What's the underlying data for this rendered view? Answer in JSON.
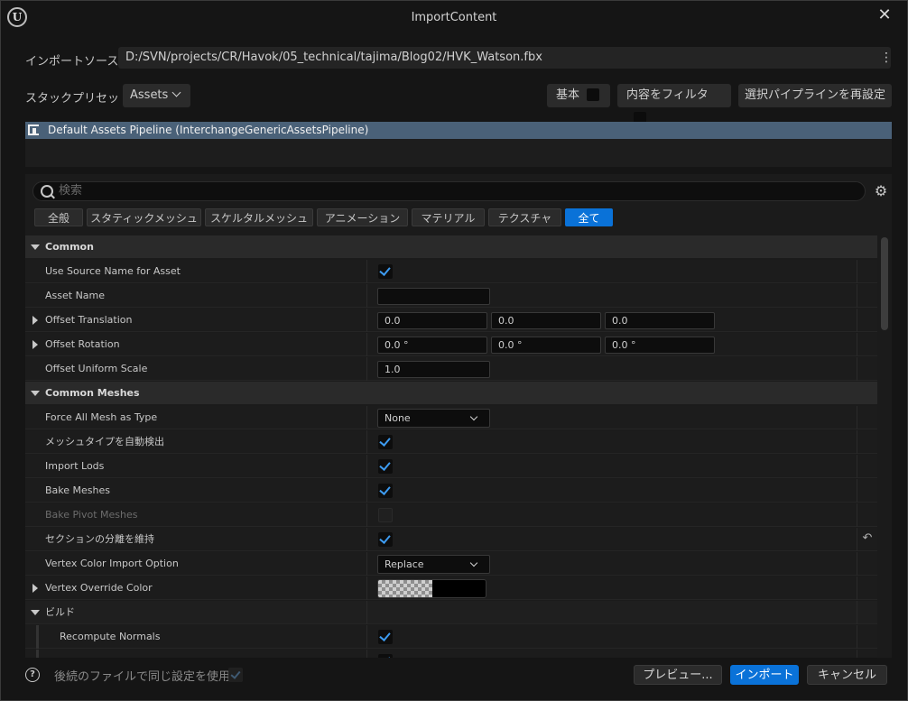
{
  "window": {
    "title": "ImportContent",
    "close_icon": "close-icon",
    "logo": "unreal-logo"
  },
  "source": {
    "label": "インポートソース",
    "path": "D:/SVN/projects/CR/Havok/05_technical/tajima/Blog02/HVK_Watson.fbx"
  },
  "stack": {
    "label": "スタックプリセット",
    "value": "Assets"
  },
  "toolbar": {
    "basic": "基本",
    "filter": "内容をフィルタ",
    "reset": "選択パイプラインを再設定"
  },
  "pipeline": {
    "label": "Default Assets Pipeline (InterchangeGenericAssetsPipeline)"
  },
  "search": {
    "placeholder": "検索"
  },
  "tabs": [
    {
      "label": "全般",
      "active": false
    },
    {
      "label": "スタティックメッシュ",
      "active": false
    },
    {
      "label": "スケルタルメッシュ",
      "active": false
    },
    {
      "label": "アニメーション",
      "active": false
    },
    {
      "label": "マテリアル",
      "active": false
    },
    {
      "label": "テクスチャ",
      "active": false
    },
    {
      "label": "全て",
      "active": true
    }
  ],
  "properties": {
    "common": {
      "label": "Common"
    },
    "use_source_name": {
      "label": "Use Source Name for Asset",
      "checked": true
    },
    "asset_name": {
      "label": "Asset Name",
      "value": ""
    },
    "offset_translation": {
      "label": "Offset Translation",
      "x": "0.0",
      "y": "0.0",
      "z": "0.0"
    },
    "offset_rotation": {
      "label": "Offset Rotation",
      "x": "0.0 °",
      "y": "0.0 °",
      "z": "0.0 °"
    },
    "offset_uniform_scale": {
      "label": "Offset Uniform Scale",
      "value": "1.0"
    },
    "common_meshes": {
      "label": "Common Meshes"
    },
    "force_all_mesh": {
      "label": "Force All Mesh as Type",
      "value": "None"
    },
    "auto_detect": {
      "label": "メッシュタイプを自動検出",
      "checked": true
    },
    "import_lods": {
      "label": "Import Lods",
      "checked": true
    },
    "bake_meshes": {
      "label": "Bake Meshes",
      "checked": true
    },
    "bake_pivot": {
      "label": "Bake Pivot Meshes",
      "checked": false
    },
    "keep_sections": {
      "label": "セクションの分離を維持",
      "checked": true
    },
    "vertex_color_import": {
      "label": "Vertex Color Import Option",
      "value": "Replace"
    },
    "vertex_override_color": {
      "label": "Vertex Override Color",
      "color": "#000000"
    },
    "build": {
      "label": "ビルド"
    },
    "recompute_normals": {
      "label": "Recompute Normals",
      "checked": true
    }
  },
  "footer": {
    "label": "後続のファイルで同じ設定を使用",
    "preview": "プレビュー...",
    "import": "インポート",
    "cancel": "キャンセル"
  },
  "colors": {
    "accent": "#0a72d8",
    "selection": "#4a6178"
  }
}
